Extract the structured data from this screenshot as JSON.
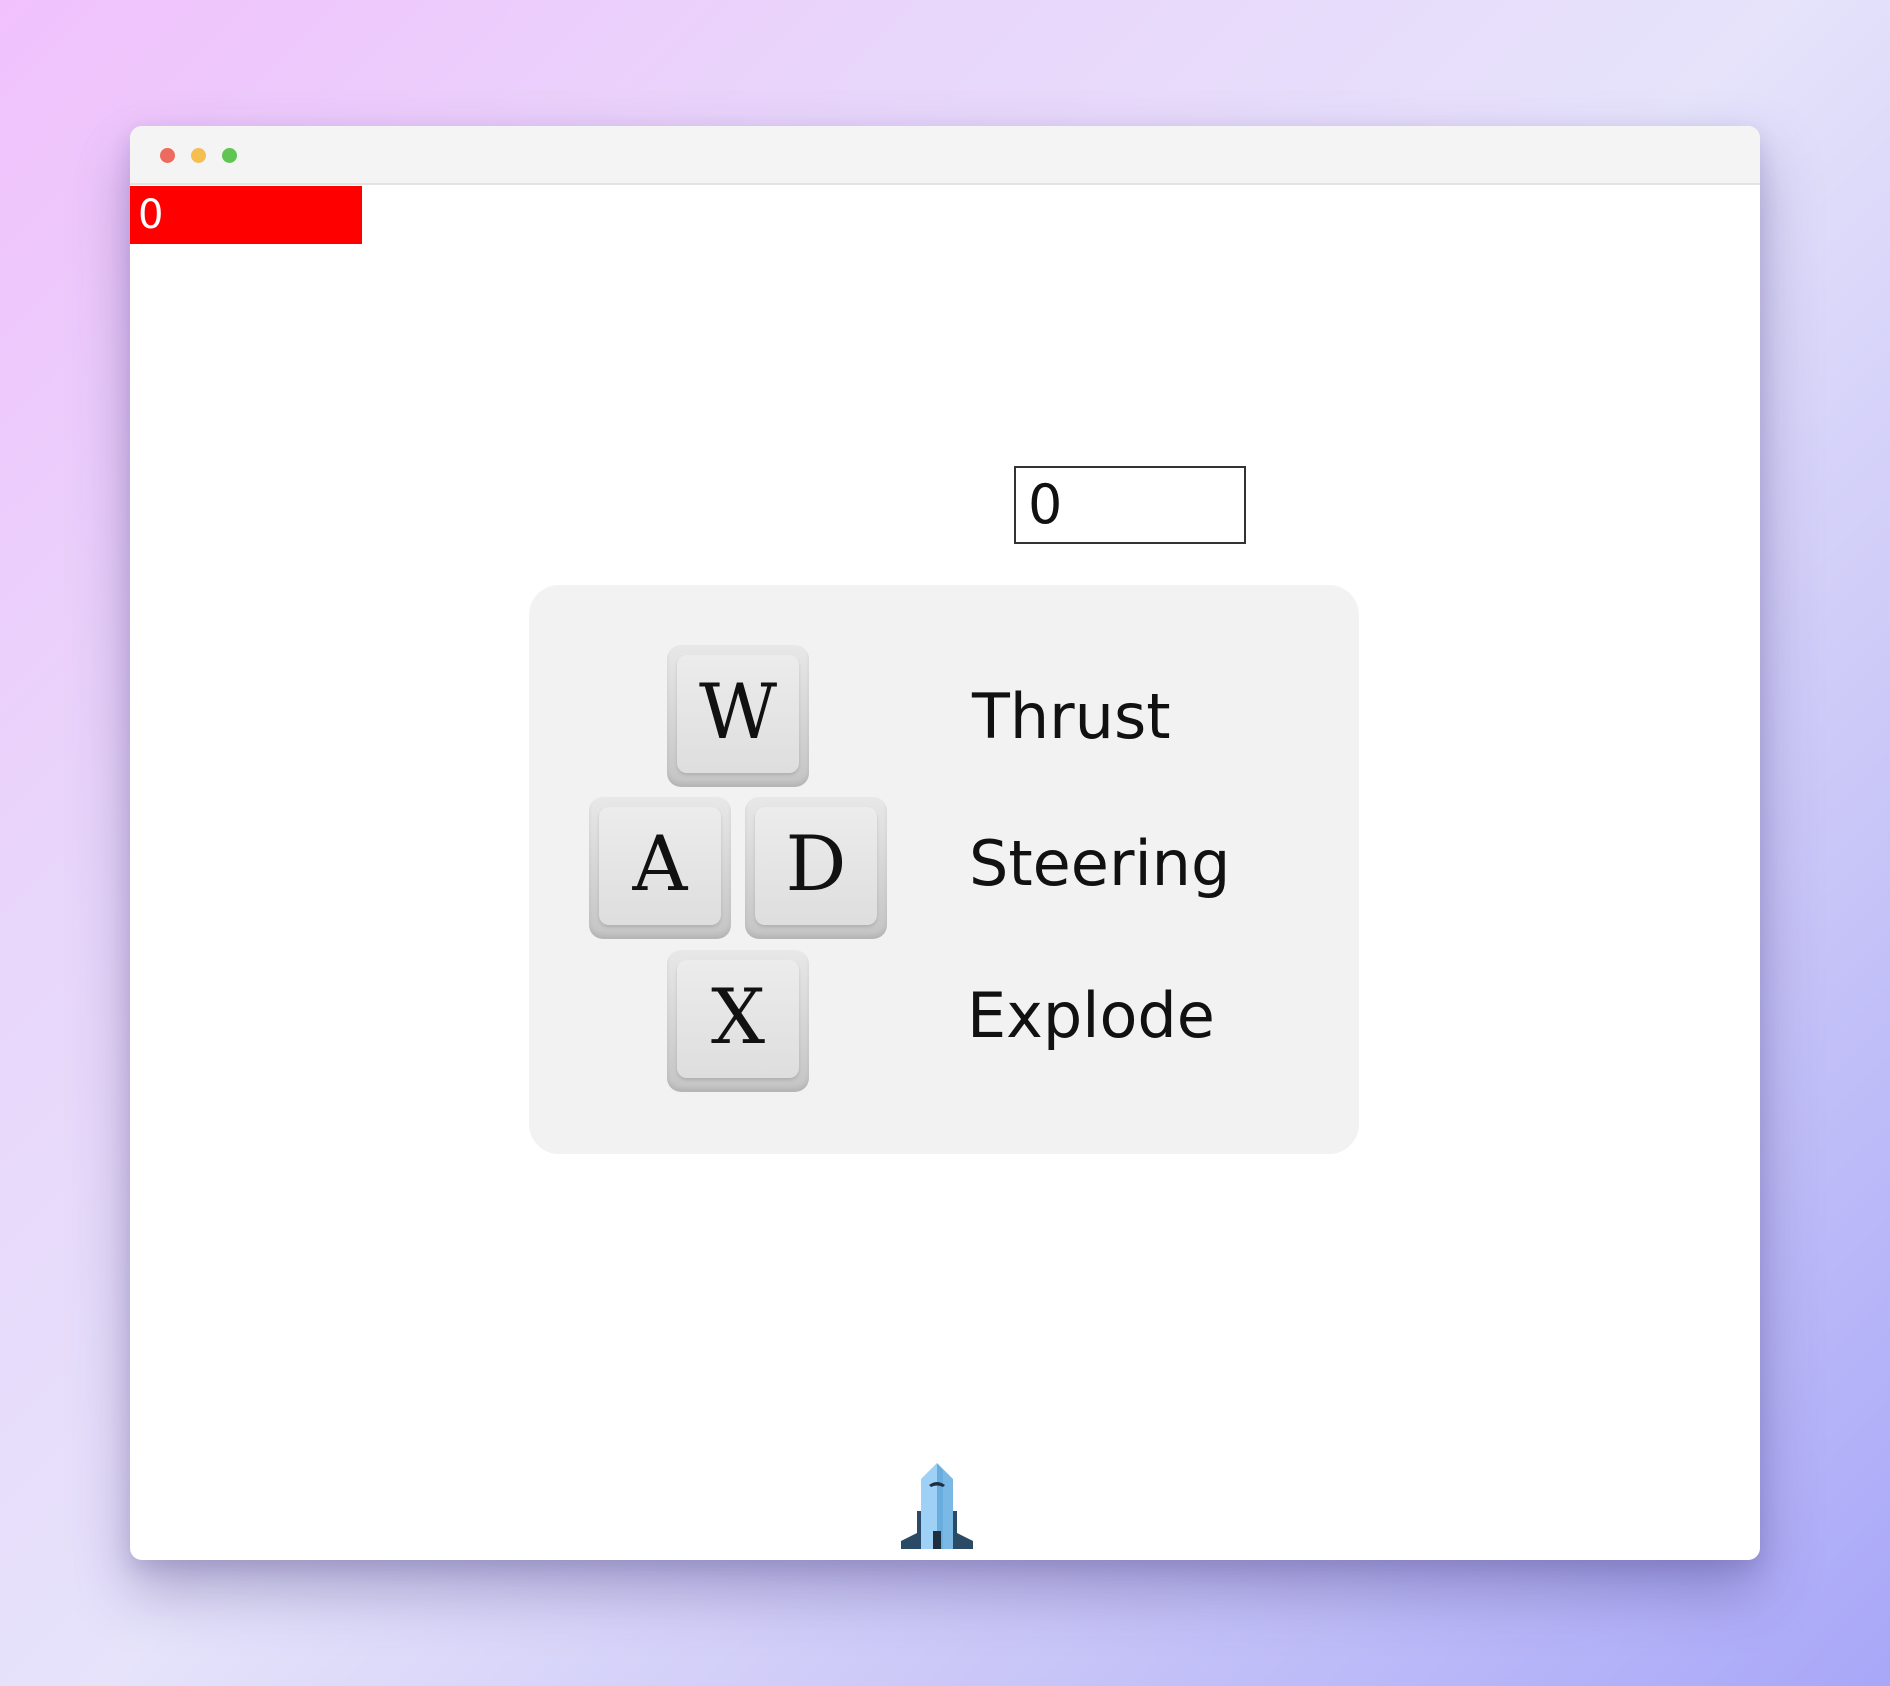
{
  "hud": {
    "health_value": "0",
    "health_color": "#ff0000",
    "score_value": "0"
  },
  "controls": {
    "keys": {
      "thrust_key": "W",
      "steer_left_key": "A",
      "steer_right_key": "D",
      "explode_key": "X"
    },
    "labels": {
      "thrust": "Thrust",
      "steering": "Steering",
      "explode": "Explode"
    }
  },
  "player": {
    "icon": "rocket-icon"
  }
}
